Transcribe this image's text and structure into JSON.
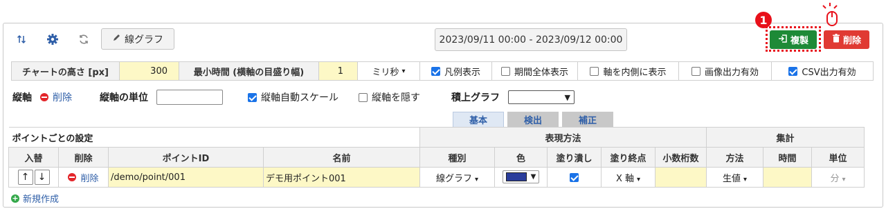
{
  "toolbar": {
    "line_graph_label": "線グラフ",
    "date_range": "2023/09/11 00:00 - 2023/09/12 00:00",
    "copy_label": "複製",
    "delete_label": "削除",
    "step_badge": "1",
    "icons": [
      "sort-arrows-icon",
      "gear-icon",
      "refresh-icon",
      "pencil-icon"
    ]
  },
  "settings": {
    "chart_height_label": "チャートの高さ [px]",
    "chart_height_value": "300",
    "min_time_label": "最小時間 (横軸の目盛り幅)",
    "min_time_value": "1",
    "min_time_unit": "ミリ秒",
    "legend_label": "凡例表示",
    "legend_checked": true,
    "full_period_label": "期間全体表示",
    "full_period_checked": false,
    "axis_inside_label": "軸を内側に表示",
    "axis_inside_checked": false,
    "image_output_label": "画像出力有効",
    "image_output_checked": false,
    "csv_output_label": "CSV出力有効",
    "csv_output_checked": true
  },
  "yaxis": {
    "label": "縦軸",
    "delete_label": "削除",
    "unit_label": "縦軸の単位",
    "unit_value": "",
    "auto_scale_label": "縦軸自動スケール",
    "auto_scale_checked": true,
    "hide_label": "縦軸を隠す",
    "hide_checked": false,
    "stacked_label": "積上グラフ",
    "stacked_value": ""
  },
  "tabs": [
    {
      "label": "基本",
      "active": true
    },
    {
      "label": "検出",
      "active": false
    },
    {
      "label": "補正",
      "active": false
    }
  ],
  "table": {
    "section_title": "ポイントごとの設定",
    "group_expression": "表現方法",
    "group_aggregate": "集計",
    "headers": [
      "入替",
      "削除",
      "ポイントID",
      "名前",
      "種別",
      "色",
      "塗り潰し",
      "塗り終点",
      "小数桁数",
      "方法",
      "時間",
      "単位"
    ],
    "rows": [
      {
        "up": "↑",
        "down": "↓",
        "delete": "削除",
        "point_id": "/demo/point/001",
        "name": "デモ用ポイント001",
        "type": "線グラフ",
        "color": "#2a3d9b",
        "fill_checked": true,
        "fill_end": "X 軸",
        "decimals": "",
        "method": "生値",
        "time": "",
        "unit": "分"
      }
    ],
    "new_label": "新規作成"
  }
}
